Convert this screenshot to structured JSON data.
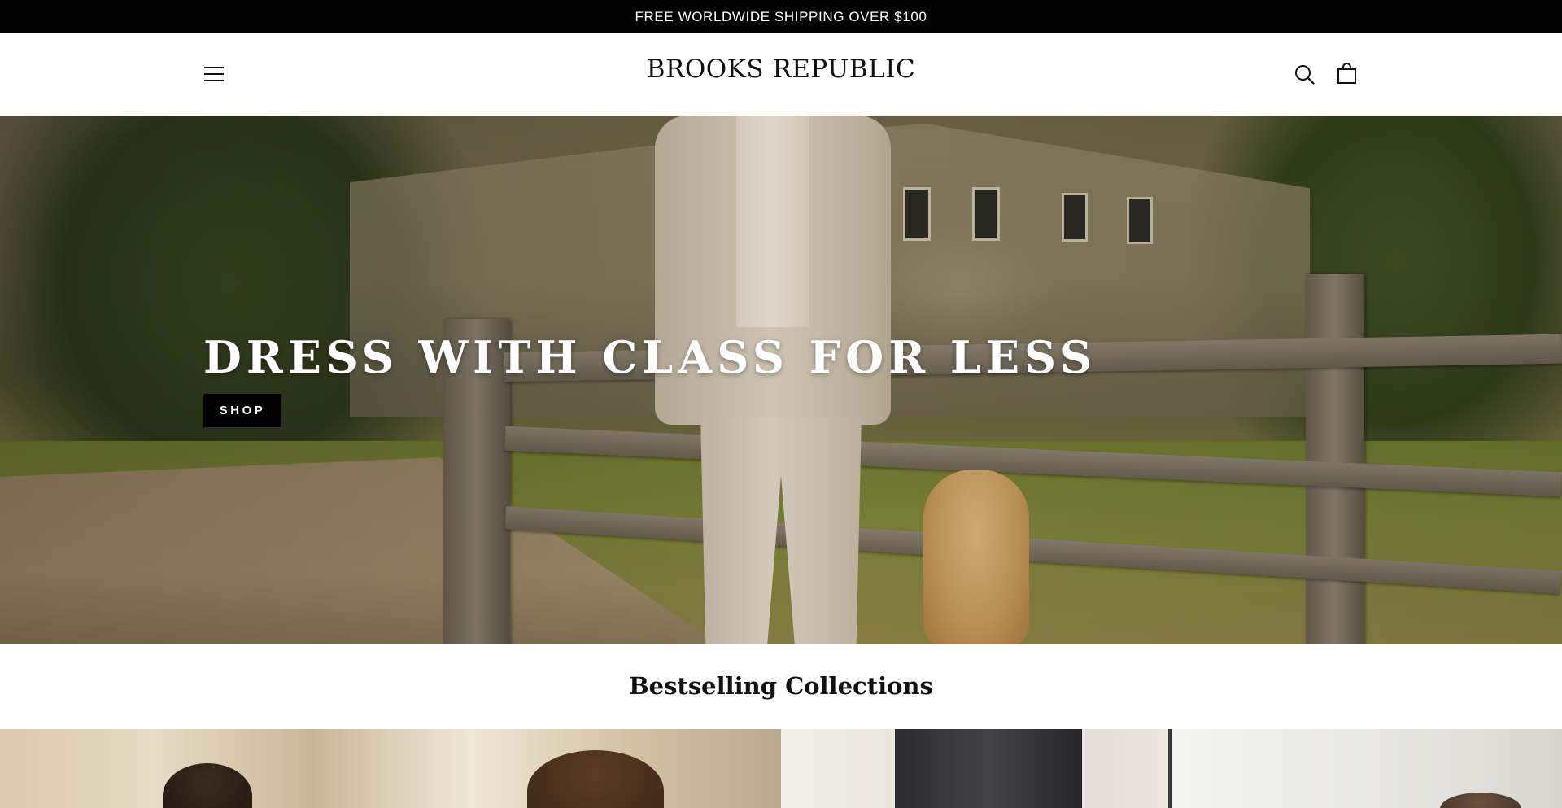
{
  "announcement": {
    "text": "FREE WORLDWIDE SHIPPING OVER $100"
  },
  "header": {
    "menu_icon": "hamburger-menu-icon",
    "logo_text": "BROOKS REPUBLIC",
    "search_icon": "search-icon",
    "cart_icon": "shopping-bag-icon"
  },
  "hero": {
    "headline": "DRESS WITH CLASS FOR LESS",
    "cta_label": "SHOP"
  },
  "bestselling": {
    "title": "Bestselling Collections"
  },
  "colors": {
    "announcement_bg": "#000000",
    "header_bg": "#ffffff",
    "button_bg": "#000000",
    "text_primary": "#111111"
  }
}
